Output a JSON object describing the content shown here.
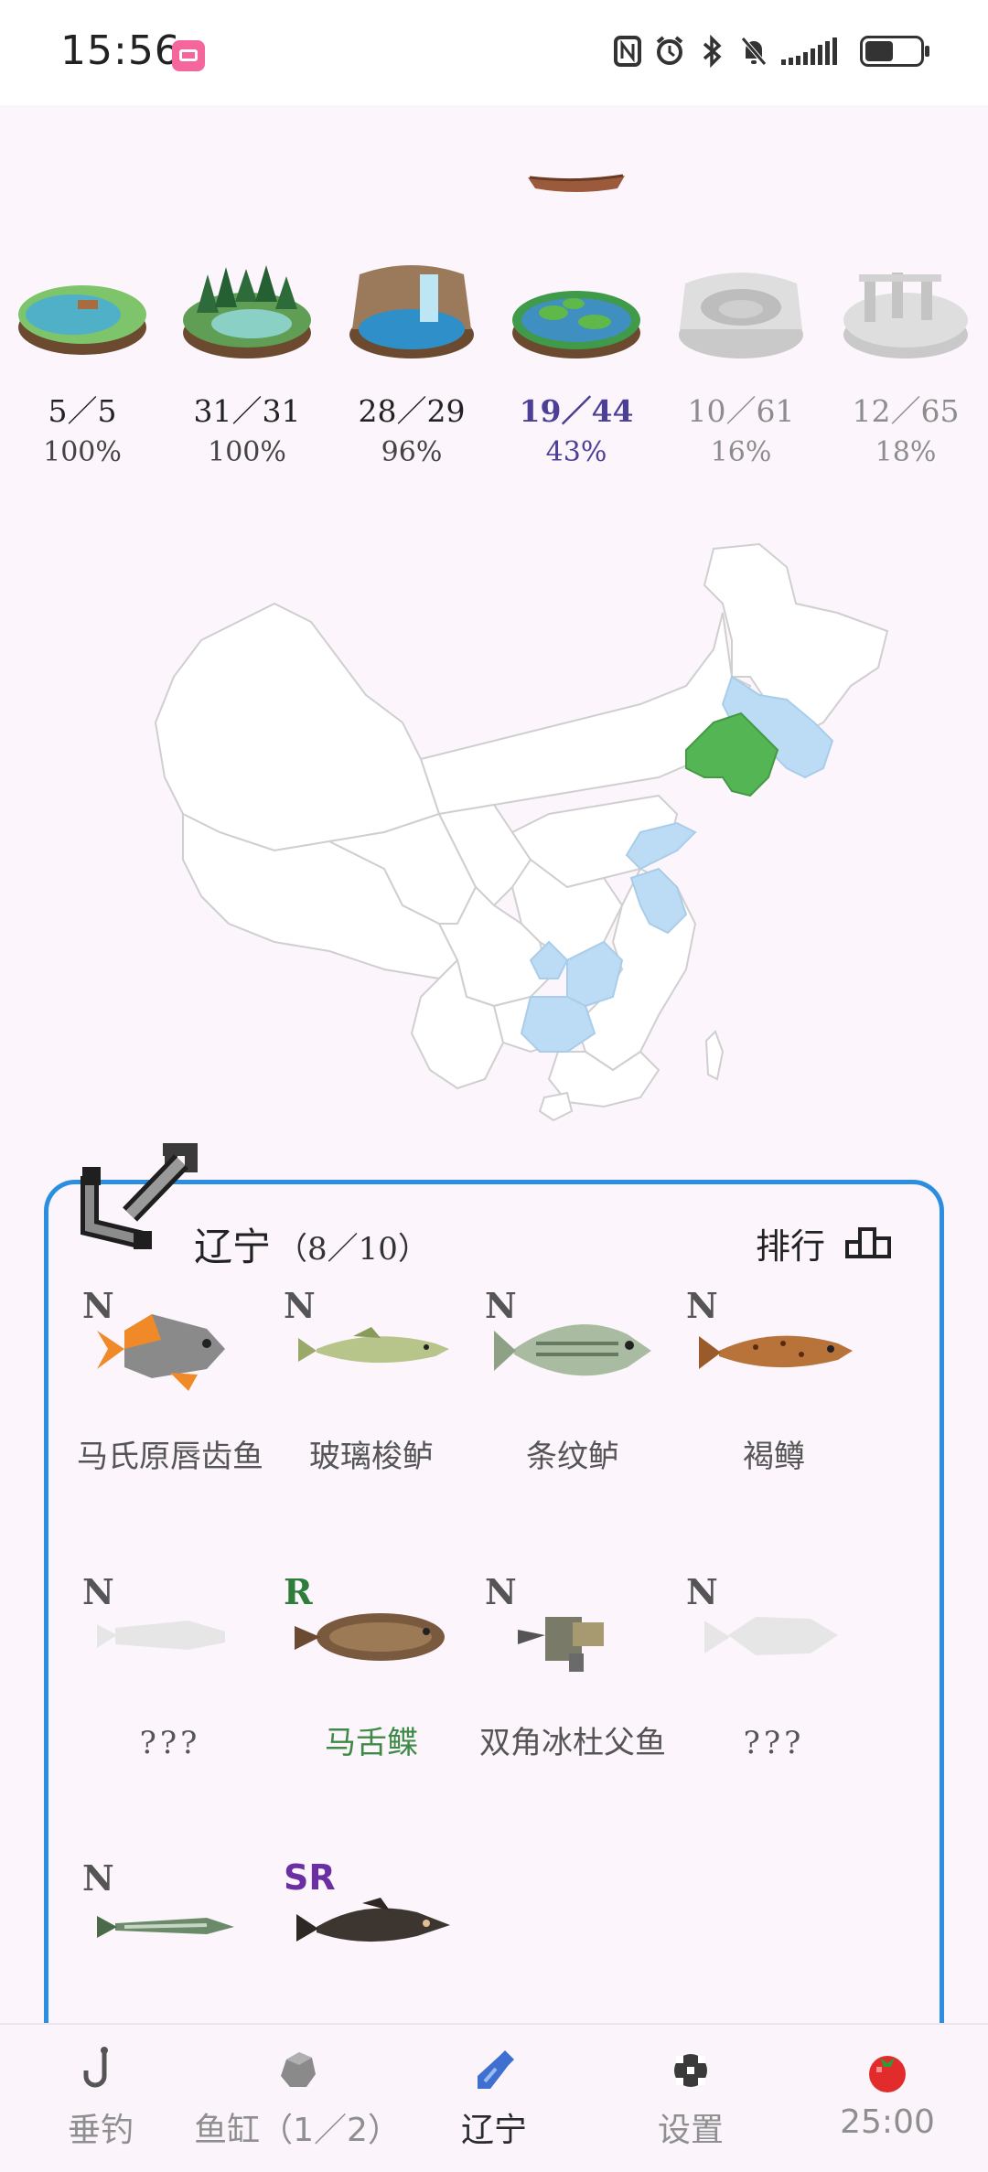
{
  "status_bar": {
    "time": "15:56",
    "icons": [
      "nfc-icon",
      "alarm-icon",
      "bluetooth-icon",
      "mute-icon",
      "signal-icon",
      "battery-icon"
    ]
  },
  "areas": [
    {
      "caught": "5／5",
      "percent": "100%",
      "state": "complete"
    },
    {
      "caught": "31／31",
      "percent": "100%",
      "state": "complete"
    },
    {
      "caught": "28／29",
      "percent": "96%",
      "state": "normal"
    },
    {
      "caught": "19／44",
      "percent": "43%",
      "state": "active"
    },
    {
      "caught": "10／61",
      "percent": "16%",
      "state": "locked"
    },
    {
      "caught": "12／65",
      "percent": "18%",
      "state": "locked"
    }
  ],
  "province": {
    "name": "辽宁",
    "count": "（8／10）",
    "rank_label": "排行"
  },
  "fish": [
    {
      "rarity": "N",
      "name": "马氏原唇齿鱼",
      "known": true
    },
    {
      "rarity": "N",
      "name": "玻璃梭鲈",
      "known": true
    },
    {
      "rarity": "N",
      "name": "条纹鲈",
      "known": true
    },
    {
      "rarity": "N",
      "name": "褐鳟",
      "known": true
    },
    {
      "rarity": "N",
      "name": "???",
      "known": false
    },
    {
      "rarity": "R",
      "name": "马舌鲽",
      "known": true
    },
    {
      "rarity": "N",
      "name": "双角冰杜父鱼",
      "known": true
    },
    {
      "rarity": "N",
      "name": "???",
      "known": false
    },
    {
      "rarity": "N",
      "name": "",
      "known": true
    },
    {
      "rarity": "SR",
      "name": "",
      "known": true
    }
  ],
  "nav": {
    "fishing": "垂钓",
    "tank": "鱼缸（1／2）",
    "province": "辽宁",
    "settings": "设置",
    "timer": "25:00"
  },
  "colors": {
    "accent_blue": "#2b8ee0",
    "map_highlight": "#53b553",
    "map_visited": "#bcdcf5",
    "active_area_text": "#4b3f96",
    "rare_green": "#2f7d3a",
    "sr_purple": "#6b2fa3"
  }
}
